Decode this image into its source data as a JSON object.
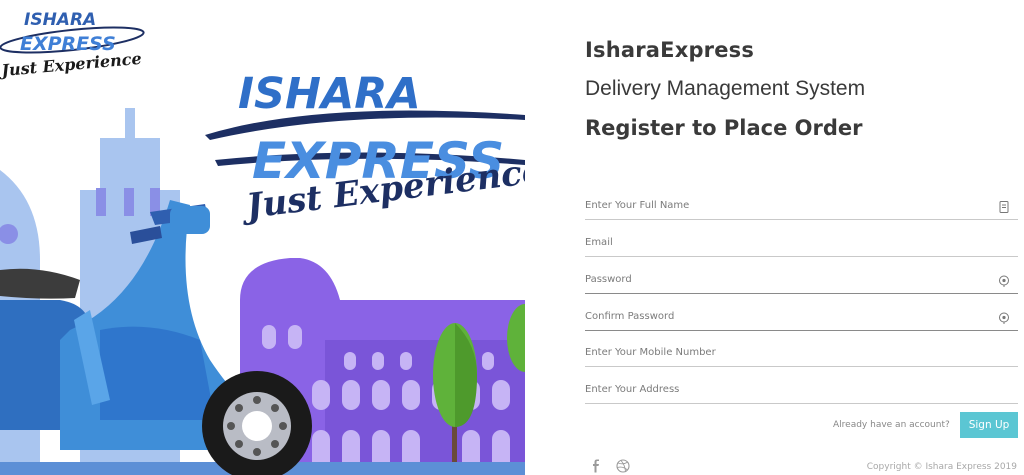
{
  "logo": {
    "line1": "ISHARA",
    "line2": "EXPRESS",
    "tagline": "Just Experience"
  },
  "brand": {
    "name": "IsharaExpress",
    "subtitle": "Delivery Management System",
    "heading": "Register to Place Order"
  },
  "form": {
    "full_name_placeholder": "Enter Your Full Name",
    "email_placeholder": "Email",
    "password_placeholder": "Password",
    "confirm_password_placeholder": "Confirm Password",
    "mobile_placeholder": "Enter Your Mobile Number",
    "address_placeholder": "Enter Your Address"
  },
  "footer": {
    "account_prompt": "Already have an account?",
    "signup_label": "Sign Up",
    "copyright": "Copyright © Ishara Express 2019"
  },
  "icons": {
    "full_name": "id-card-icon",
    "password": "eye-icon",
    "confirm_password": "eye-icon",
    "social_1": "facebook-icon",
    "social_2": "dribbble-icon"
  },
  "colors": {
    "accent": "#5bc6d3",
    "logo_blue": "#2f5fb0",
    "logo_navy": "#1d2f63",
    "scooter_blue": "#3f8ed8",
    "building_purple": "#8a63e6",
    "building_blue": "#a9c5ef",
    "tree_green": "#5fb23a"
  }
}
